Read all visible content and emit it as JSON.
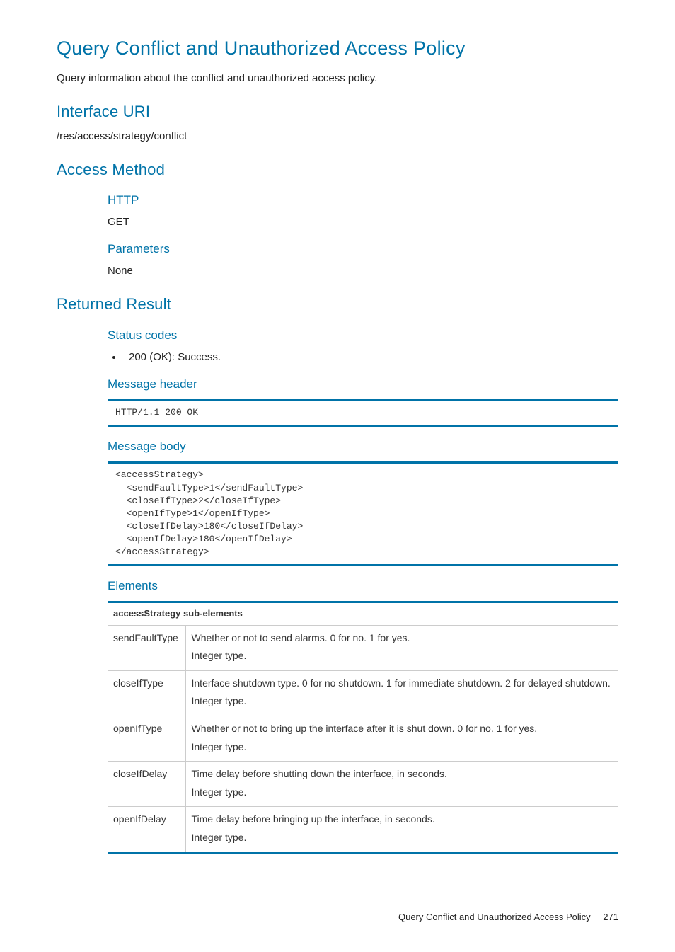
{
  "title": "Query Conflict and Unauthorized Access Policy",
  "intro": "Query information about the conflict and unauthorized access policy.",
  "sections": {
    "interface_uri": {
      "heading": "Interface URI",
      "value": "/res/access/strategy/conflict"
    },
    "access_method": {
      "heading": "Access Method",
      "http_label": "HTTP",
      "http_value": "GET",
      "params_label": "Parameters",
      "params_value": "None"
    },
    "returned_result": {
      "heading": "Returned Result",
      "status_codes_label": "Status codes",
      "status_codes_item": "200 (OK): Success.",
      "message_header_label": "Message header",
      "message_header_code": "HTTP/1.1 200 OK",
      "message_body_label": "Message body",
      "message_body_code": "<accessStrategy>\n  <sendFaultType>1</sendFaultType>\n  <closeIfType>2</closeIfType>\n  <openIfType>1</openIfType>\n  <closeIfDelay>180</closeIfDelay>\n  <openIfDelay>180</openIfDelay>\n</accessStrategy>",
      "elements_label": "Elements",
      "table_header": "accessStrategy sub-elements",
      "rows": [
        {
          "name": "sendFaultType",
          "desc1": "Whether or not to send alarms. 0 for no. 1 for yes.",
          "desc2": "Integer type."
        },
        {
          "name": "closeIfType",
          "desc1": "Interface shutdown type. 0 for no shutdown. 1 for immediate shutdown. 2 for delayed shutdown.",
          "desc2": "Integer type."
        },
        {
          "name": "openIfType",
          "desc1": "Whether or not to bring up the interface after it is shut down. 0 for no. 1 for yes.",
          "desc2": "Integer type."
        },
        {
          "name": "closeIfDelay",
          "desc1": "Time delay before shutting down the interface, in seconds.",
          "desc2": "Integer type."
        },
        {
          "name": "openIfDelay",
          "desc1": "Time delay before bringing up the interface, in seconds.",
          "desc2": "Integer type."
        }
      ]
    }
  },
  "footer": {
    "text": "Query Conflict and Unauthorized Access Policy",
    "page": "271"
  }
}
